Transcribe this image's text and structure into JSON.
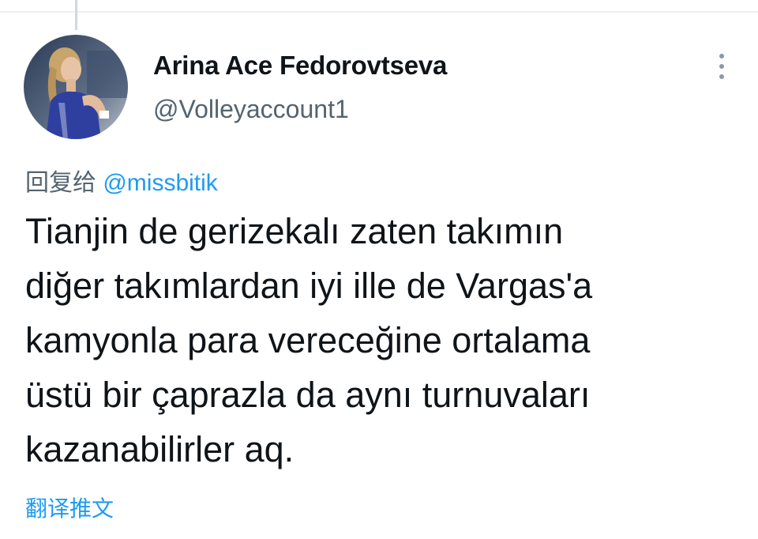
{
  "tweet": {
    "author": {
      "display_name": "Arina Ace Fedorovtseva",
      "handle": "@Volleyaccount1",
      "avatar_icon": "profile-photo"
    },
    "reply_to": {
      "prefix": "回复给",
      "mention": "@missbitik"
    },
    "text": "Tianjin de gerizekalı zaten takımın\ndiğer takımlardan iyi ille de Vargas'a\nkamyonla para vereceğine ortalama\nüstü bir çaprazla da aynı turnuvaları\nkazanabilirler aq.",
    "translate_label": "翻译推文",
    "more_icon": "more-vertical-icon"
  },
  "colors": {
    "text_primary": "#0f1419",
    "text_secondary": "#536471",
    "accent": "#1d9bf0",
    "divider": "#eceef0"
  }
}
